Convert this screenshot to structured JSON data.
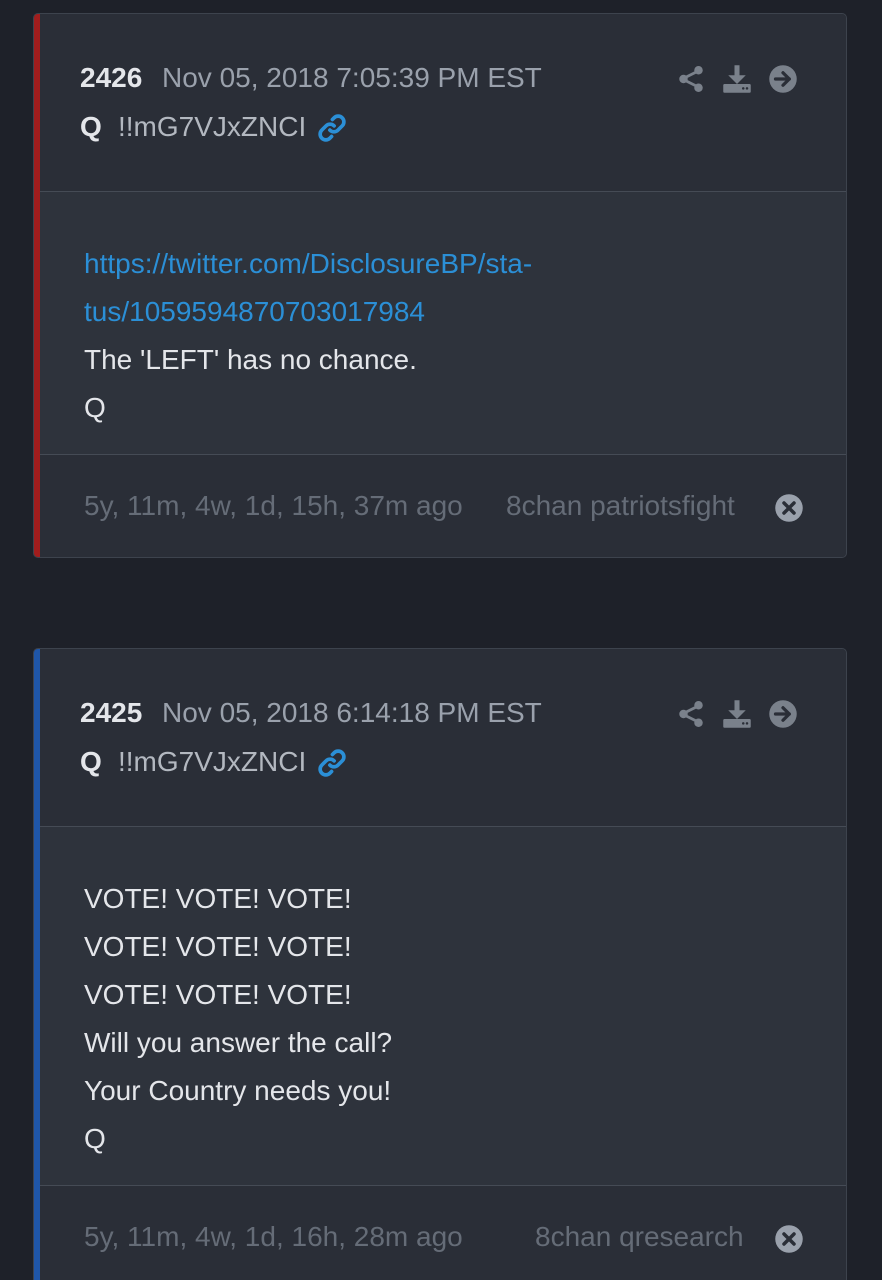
{
  "colors": {
    "background": "#1e2129",
    "card": "#2e333c",
    "card_header": "#2a2e37",
    "link": "#2b8fd6",
    "accent_red": "#a11d1d",
    "accent_blue": "#1f56a8",
    "icon": "#7a818b"
  },
  "posts": [
    {
      "number": "2426",
      "timestamp": "Nov 05, 2018 7:05:39 PM EST",
      "author": "Q",
      "tripcode": "!!mG7VJxZNCI",
      "accent_color": "#a11d1d",
      "link_line_1": "https://twitter.com/DisclosureBP/sta-",
      "link_line_2": "tus/1059594870703017984",
      "text_lines": [
        "The 'LEFT' has no chance.",
        "Q"
      ],
      "ago": "5y, 11m, 4w, 1d, 15h, 37m ago",
      "board": "8chan patriotsfight",
      "icons": [
        "share-icon",
        "download-icon",
        "arrow-right-circle-icon",
        "link-chain-icon",
        "close-circle-icon"
      ]
    },
    {
      "number": "2425",
      "timestamp": "Nov 05, 2018 6:14:18 PM EST",
      "author": "Q",
      "tripcode": "!!mG7VJxZNCI",
      "accent_color": "#1f56a8",
      "text_lines": [
        "VOTE! VOTE! VOTE!",
        "VOTE! VOTE! VOTE!",
        "VOTE! VOTE! VOTE!",
        "Will you answer the call?",
        "Your Country needs you!",
        "Q"
      ],
      "ago": "5y, 11m, 4w, 1d, 16h, 28m ago",
      "board": "8chan qresearch",
      "icons": [
        "share-icon",
        "download-icon",
        "arrow-right-circle-icon",
        "link-chain-icon",
        "close-circle-icon"
      ]
    }
  ]
}
